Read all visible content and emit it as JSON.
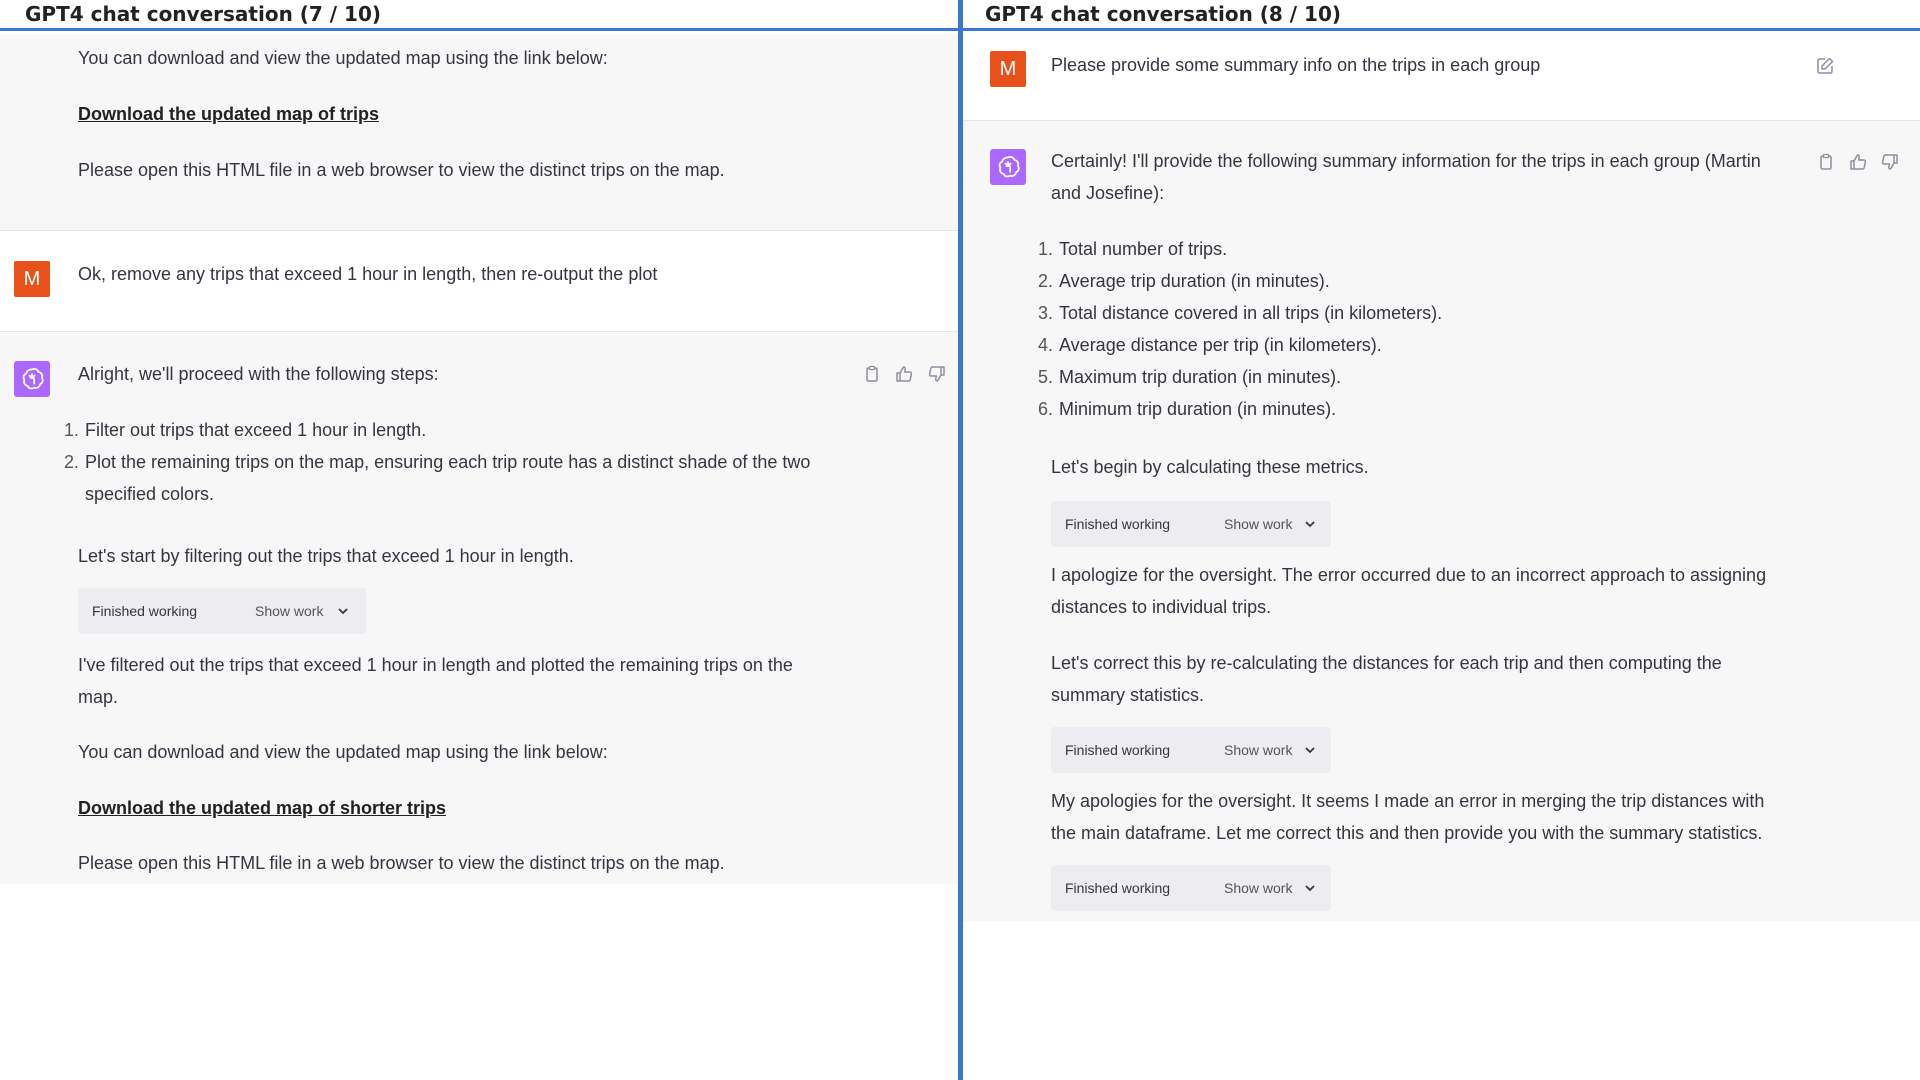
{
  "left": {
    "title": "GPT4 chat conversation (7 / 10)",
    "top_block": {
      "line1": "You can download and view the updated map using the link below:",
      "link": "Download the updated map of trips",
      "line2": "Please open this HTML file in a web browser to view the distinct trips on the map."
    },
    "user_msg": {
      "avatar": "M",
      "text": "Ok, remove any trips that exceed 1 hour in length, then re-output the plot"
    },
    "assistant": {
      "intro": "Alright, we'll proceed with the following steps:",
      "steps": [
        {
          "num": "1.",
          "text": "Filter out trips that exceed 1 hour in length."
        },
        {
          "num": "2.",
          "text": "Plot the remaining trips on the map, ensuring each trip route has a distinct shade of the two"
        },
        {
          "num": "",
          "text": "specified colors."
        }
      ],
      "start": "Let's start by filtering out the trips that exceed 1 hour in length.",
      "work_finished": "Finished working",
      "work_show": "Show work",
      "filtered_line1": "I've filtered out the trips that exceed 1 hour in length and plotted the remaining trips on the",
      "filtered_line2": "map.",
      "download_line": "You can download and view the updated map using the link below:",
      "link": "Download the updated map of shorter trips",
      "open_line": "Please open this HTML file in a web browser to view the distinct trips on the map."
    }
  },
  "right": {
    "title": "GPT4 chat conversation (8 / 10)",
    "user_msg": {
      "avatar": "M",
      "text": "Please provide some summary info on the trips in each group"
    },
    "assistant": {
      "intro_line1": "Certainly! I'll provide the following summary information for the trips in each group (Martin",
      "intro_line2": "and Josefine):",
      "items": [
        {
          "num": "1.",
          "text": "Total number of trips."
        },
        {
          "num": "2.",
          "text": "Average trip duration (in minutes)."
        },
        {
          "num": "3.",
          "text": "Total distance covered in all trips (in kilometers)."
        },
        {
          "num": "4.",
          "text": "Average distance per trip (in kilometers)."
        },
        {
          "num": "5.",
          "text": "Maximum trip duration (in minutes)."
        },
        {
          "num": "6.",
          "text": "Minimum trip duration (in minutes)."
        }
      ],
      "begin": "Let's begin by calculating these metrics.",
      "work_finished": "Finished working",
      "work_show": "Show work",
      "apology1_line1": "I apologize for the oversight. The error occurred due to an incorrect approach to assigning",
      "apology1_line2": "distances to individual trips.",
      "correct_line1": "Let's correct this by re-calculating the distances for each trip and then computing the",
      "correct_line2": "summary statistics.",
      "apology2_line1": "My apologies for the oversight. It seems I made an error in merging the trip distances with",
      "apology2_line2": "the main dataframe. Let me correct this and then provide you with the summary statistics."
    }
  },
  "colors": {
    "accent_blue": "#3a78c9",
    "user_avatar": "#e8501c",
    "gpt_avatar": "#ab68ff",
    "assistant_bg": "#f7f7f8"
  }
}
